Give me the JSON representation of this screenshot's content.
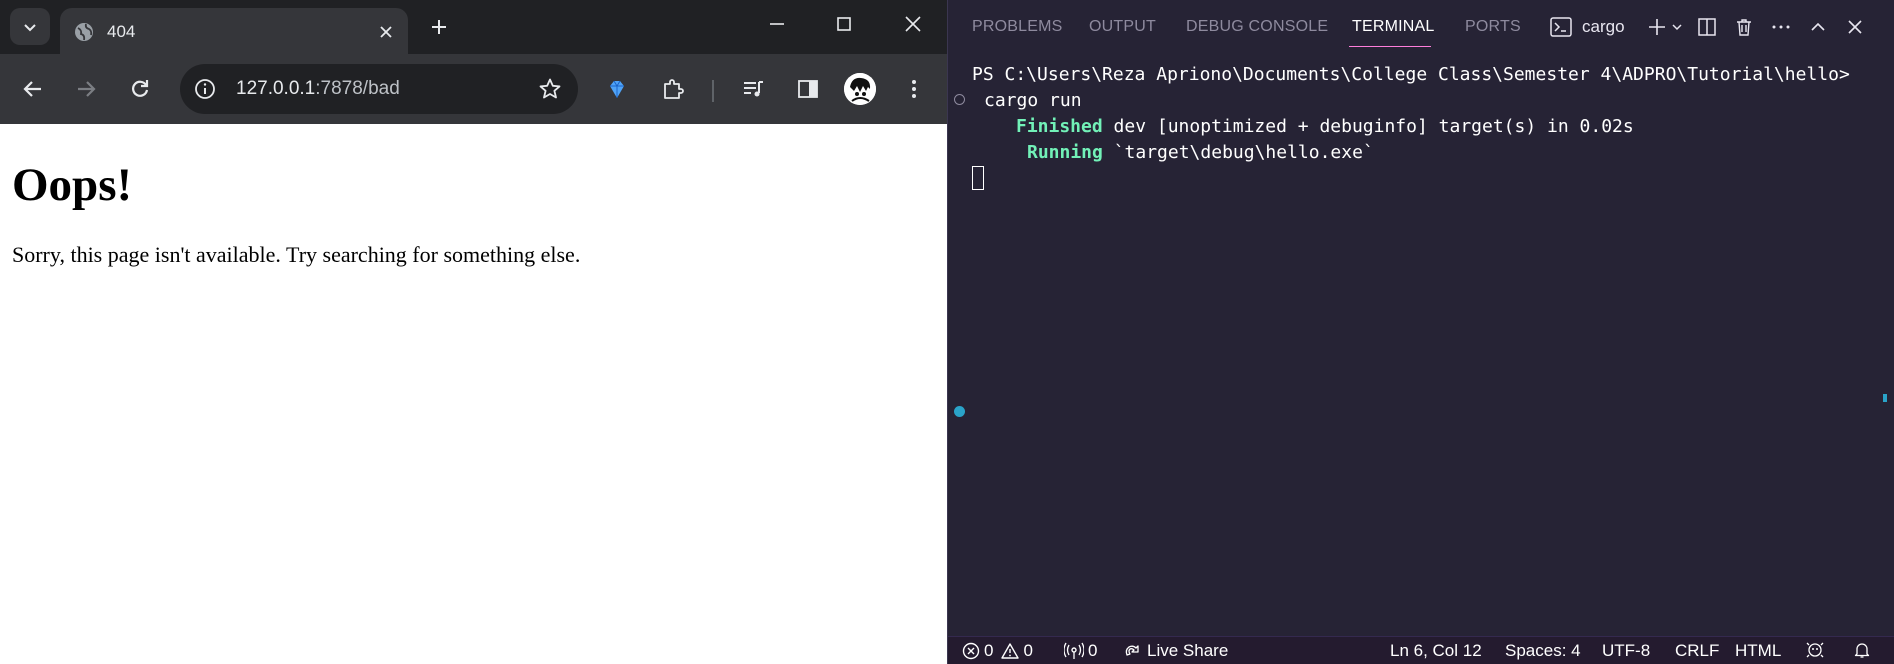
{
  "browser": {
    "tab": {
      "title": "404"
    },
    "omnibox": {
      "host": "127.0.0.1",
      "rest": ":7878/bad"
    },
    "page": {
      "heading": "Oops!",
      "message": "Sorry, this page isn't available. Try searching for something else."
    }
  },
  "vscode": {
    "panel_tabs": [
      "PROBLEMS",
      "OUTPUT",
      "DEBUG CONSOLE",
      "TERMINAL",
      "PORTS"
    ],
    "active_tab": "TERMINAL",
    "terminal_name": "cargo",
    "terminal": {
      "prompt": "PS C:\\Users\\Reza Apriono\\Documents\\College Class\\Semester 4\\ADPRO\\Tutorial\\hello>",
      "command": "cargo run",
      "line1_keyword": "Finished",
      "line1_rest": " dev [unoptimized + debuginfo] target(s) in 0.02s",
      "line2_keyword": "Running",
      "line2_rest": " `target\\debug\\hello.exe`"
    },
    "statusbar": {
      "errors": "0",
      "warnings": "0",
      "ports": "0",
      "live_share": "Live Share",
      "position": "Ln 6, Col 12",
      "spaces": "Spaces: 4",
      "encoding": "UTF-8",
      "eol": "CRLF",
      "language": "HTML"
    }
  },
  "colors": {
    "terminal_bg": "#262335",
    "accent_green": "#72f1b8",
    "active_tab_underline": "#ff7edb",
    "statusbar_bg": "#241b2f"
  }
}
